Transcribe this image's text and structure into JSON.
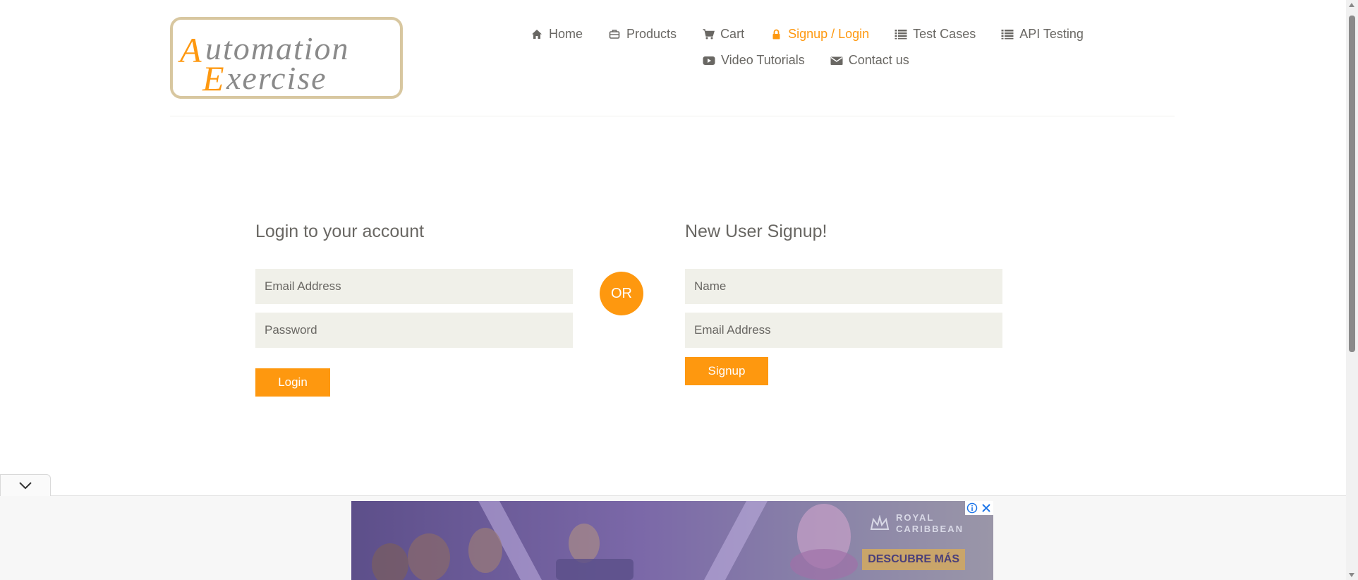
{
  "colors": {
    "accent": "#FE980F",
    "text": "#696763",
    "field_bg": "#F0F0E9"
  },
  "header": {
    "logo": {
      "line1": "Automation",
      "line2": "Exercise"
    },
    "nav": [
      {
        "label": "Home",
        "icon": "home-icon",
        "active": false
      },
      {
        "label": "Products",
        "icon": "briefcase-icon",
        "active": false
      },
      {
        "label": "Cart",
        "icon": "cart-icon",
        "active": false
      },
      {
        "label": "Signup / Login",
        "icon": "lock-icon",
        "active": true
      },
      {
        "label": "Test Cases",
        "icon": "list-icon",
        "active": false
      },
      {
        "label": "API Testing",
        "icon": "list-icon",
        "active": false
      },
      {
        "label": "Video Tutorials",
        "icon": "youtube-play-icon",
        "active": false
      },
      {
        "label": "Contact us",
        "icon": "envelope-icon",
        "active": false
      }
    ]
  },
  "login": {
    "title": "Login to your account",
    "email_placeholder": "Email Address",
    "password_placeholder": "Password",
    "button": "Login"
  },
  "divider": {
    "label": "OR"
  },
  "signup": {
    "title": "New User Signup!",
    "name_placeholder": "Name",
    "email_placeholder": "Email Address",
    "button": "Signup"
  },
  "ad": {
    "brand_line1": "ROYAL",
    "brand_line2": "CARIBBEAN",
    "cta": "DESCUBRE MÁS",
    "info_icon": "info-icon",
    "close_icon": "close-icon",
    "collapse_icon": "chevron-down-icon"
  }
}
